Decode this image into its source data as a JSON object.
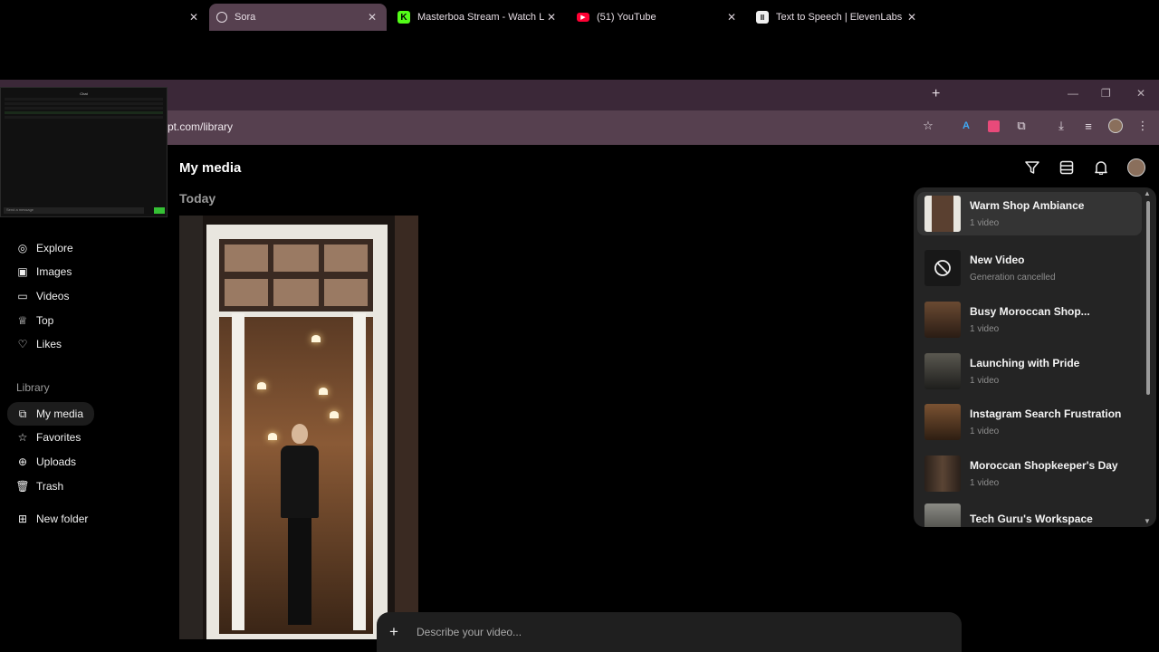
{
  "browser": {
    "tabs": [
      {
        "title": "",
        "favicon": "blank"
      },
      {
        "title": "Sora",
        "favicon": "sora-icon",
        "active": true
      },
      {
        "title": "Masterboa Stream - Watch Live",
        "favicon": "kick-icon"
      },
      {
        "title": "(51) YouTube",
        "favicon": "youtube-icon"
      },
      {
        "title": "Text to Speech | ElevenLabs",
        "favicon": "elevenlabs-icon"
      }
    ],
    "url": "pt.com/library",
    "window_controls": {
      "minimize": "—",
      "restore": "❐",
      "close": "✕"
    }
  },
  "overlay": {
    "title": "Chat",
    "input_placeholder": "Send a message"
  },
  "sidebar": {
    "nav": [
      {
        "label": "Explore",
        "icon": "compass-icon"
      },
      {
        "label": "Images",
        "icon": "image-icon"
      },
      {
        "label": "Videos",
        "icon": "video-icon"
      },
      {
        "label": "Top",
        "icon": "trophy-icon"
      },
      {
        "label": "Likes",
        "icon": "heart-icon"
      }
    ],
    "library_heading": "Library",
    "library": [
      {
        "label": "My media",
        "icon": "media-icon",
        "active": true
      },
      {
        "label": "Favorites",
        "icon": "star-icon"
      },
      {
        "label": "Uploads",
        "icon": "upload-icon"
      },
      {
        "label": "Trash",
        "icon": "trash-icon"
      }
    ],
    "new_folder": {
      "label": "New folder",
      "icon": "folder-plus-icon"
    }
  },
  "main": {
    "title": "My media",
    "section": "Today"
  },
  "panel": {
    "items": [
      {
        "title": "Warm Shop Ambiance",
        "sub": "1 video",
        "thumb": "#5a4030"
      },
      {
        "title": "New Video",
        "sub": "Generation cancelled",
        "thumb": "cancel"
      },
      {
        "title": "Busy Moroccan Shop...",
        "sub": "1 video",
        "thumb": "#4a3022"
      },
      {
        "title": "Launching with Pride",
        "sub": "1 video",
        "thumb": "#3b3a35"
      },
      {
        "title": "Instagram Search Frustration",
        "sub": "1 video",
        "thumb": "#5a3c26"
      },
      {
        "title": "Moroccan Shopkeeper's Day",
        "sub": "1 video",
        "thumb": "#3d2e26"
      },
      {
        "title": "Tech Guru's Workspace",
        "sub": "",
        "thumb": "#6a6a64"
      }
    ]
  },
  "prompt": {
    "placeholder": "Describe your video..."
  }
}
